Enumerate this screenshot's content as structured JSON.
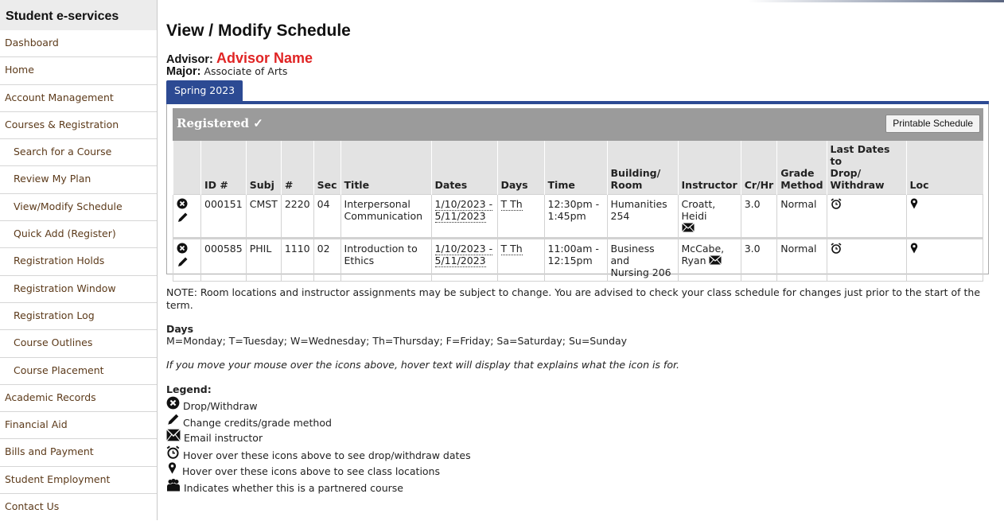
{
  "sidebar": {
    "title": "Student e-services",
    "items": [
      {
        "label": "Dashboard",
        "sub": false
      },
      {
        "label": "Home",
        "sub": false
      },
      {
        "label": "Account Management",
        "sub": false
      },
      {
        "label": "Courses & Registration",
        "sub": false
      },
      {
        "label": "Search for a Course",
        "sub": true
      },
      {
        "label": "Review My Plan",
        "sub": true
      },
      {
        "label": "View/Modify Schedule",
        "sub": true
      },
      {
        "label": "Quick Add (Register)",
        "sub": true
      },
      {
        "label": "Registration Holds",
        "sub": true
      },
      {
        "label": "Registration Window",
        "sub": true
      },
      {
        "label": "Registration Log",
        "sub": true
      },
      {
        "label": "Course Outlines",
        "sub": true
      },
      {
        "label": "Course Placement",
        "sub": true
      },
      {
        "label": "Academic Records",
        "sub": false
      },
      {
        "label": "Financial Aid",
        "sub": false
      },
      {
        "label": "Bills and Payment",
        "sub": false
      },
      {
        "label": "Student Employment",
        "sub": false
      },
      {
        "label": "Contact Us",
        "sub": false
      }
    ]
  },
  "page": {
    "title": "View / Modify Schedule",
    "advisor_label": "Advisor:",
    "advisor_name": "Advisor Name",
    "major_label": "Major:",
    "major_value": "Associate of Arts",
    "tab_label": "Spring 2023",
    "registered_label": "Registered ✓",
    "print_button": "Printable Schedule"
  },
  "table": {
    "headers": {
      "id": "ID #",
      "subj": "Subj",
      "num": "#",
      "sec": "Sec",
      "title": "Title",
      "dates": "Dates",
      "days": "Days",
      "time": "Time",
      "room_1": "Building/",
      "room_2": "Room",
      "instructor": "Instructor",
      "crhr": "Cr/Hr",
      "grade_1": "Grade",
      "grade_2": "Method",
      "last_1": "Last Dates to",
      "last_2": "Drop/",
      "last_3": "Withdraw",
      "loc": "Loc"
    },
    "rows": [
      {
        "id": "000151",
        "subj": "CMST",
        "num": "2220",
        "sec": "04",
        "title_1": "Interpersonal",
        "title_2": "Communication",
        "date_start": "1/10/2023 -",
        "date_end": "5/11/2023",
        "days": "T Th",
        "time_1": "12:30pm -",
        "time_2": "1:45pm",
        "room_1": "Humanities",
        "room_2": "254",
        "instructor": "Croatt, Heidi",
        "crhr": "3.0",
        "grade": "Normal"
      },
      {
        "id": "000585",
        "subj": "PHIL",
        "num": "1110",
        "sec": "02",
        "title_1": "Introduction to",
        "title_2": "Ethics",
        "date_start": "1/10/2023 -",
        "date_end": "5/11/2023",
        "days": "T Th",
        "time_1": "11:00am -",
        "time_2": "12:15pm",
        "room_1": "Business and",
        "room_2": "Nursing 206",
        "instructor": "McCabe,",
        "instructor_2": "Ryan",
        "crhr": "3.0",
        "grade": "Normal"
      }
    ]
  },
  "notes": {
    "note": "NOTE: Room locations and instructor assignments may be subject to change. You are advised to check your class schedule for changes just prior to the start of the term.",
    "days_heading": "Days",
    "days_text": "M=Monday; T=Tuesday; W=Wednesday; Th=Thursday; F=Friday; Sa=Saturday; Su=Sunday",
    "hover_text": "If you move your mouse over the icons above, hover text will display that explains what the icon is for.",
    "legend_heading": "Legend:",
    "legend": [
      {
        "icon": "drop-icon",
        "text": "Drop/Withdraw"
      },
      {
        "icon": "pencil-icon",
        "text": "Change credits/grade method"
      },
      {
        "icon": "email-icon",
        "text": "Email instructor"
      },
      {
        "icon": "alarm-clock-icon",
        "text": "Hover over these icons above to see drop/withdraw dates"
      },
      {
        "icon": "map-pin-icon",
        "text": "Hover over these icons above to see class locations"
      },
      {
        "icon": "people-icon",
        "text": "Indicates whether this is a partnered course"
      }
    ]
  },
  "colors": {
    "accent_blue": "#2c4a93",
    "advisor_red": "#e02424",
    "sidebar_link": "#5c3a1a",
    "registered_bar": "#9b9b9b"
  }
}
